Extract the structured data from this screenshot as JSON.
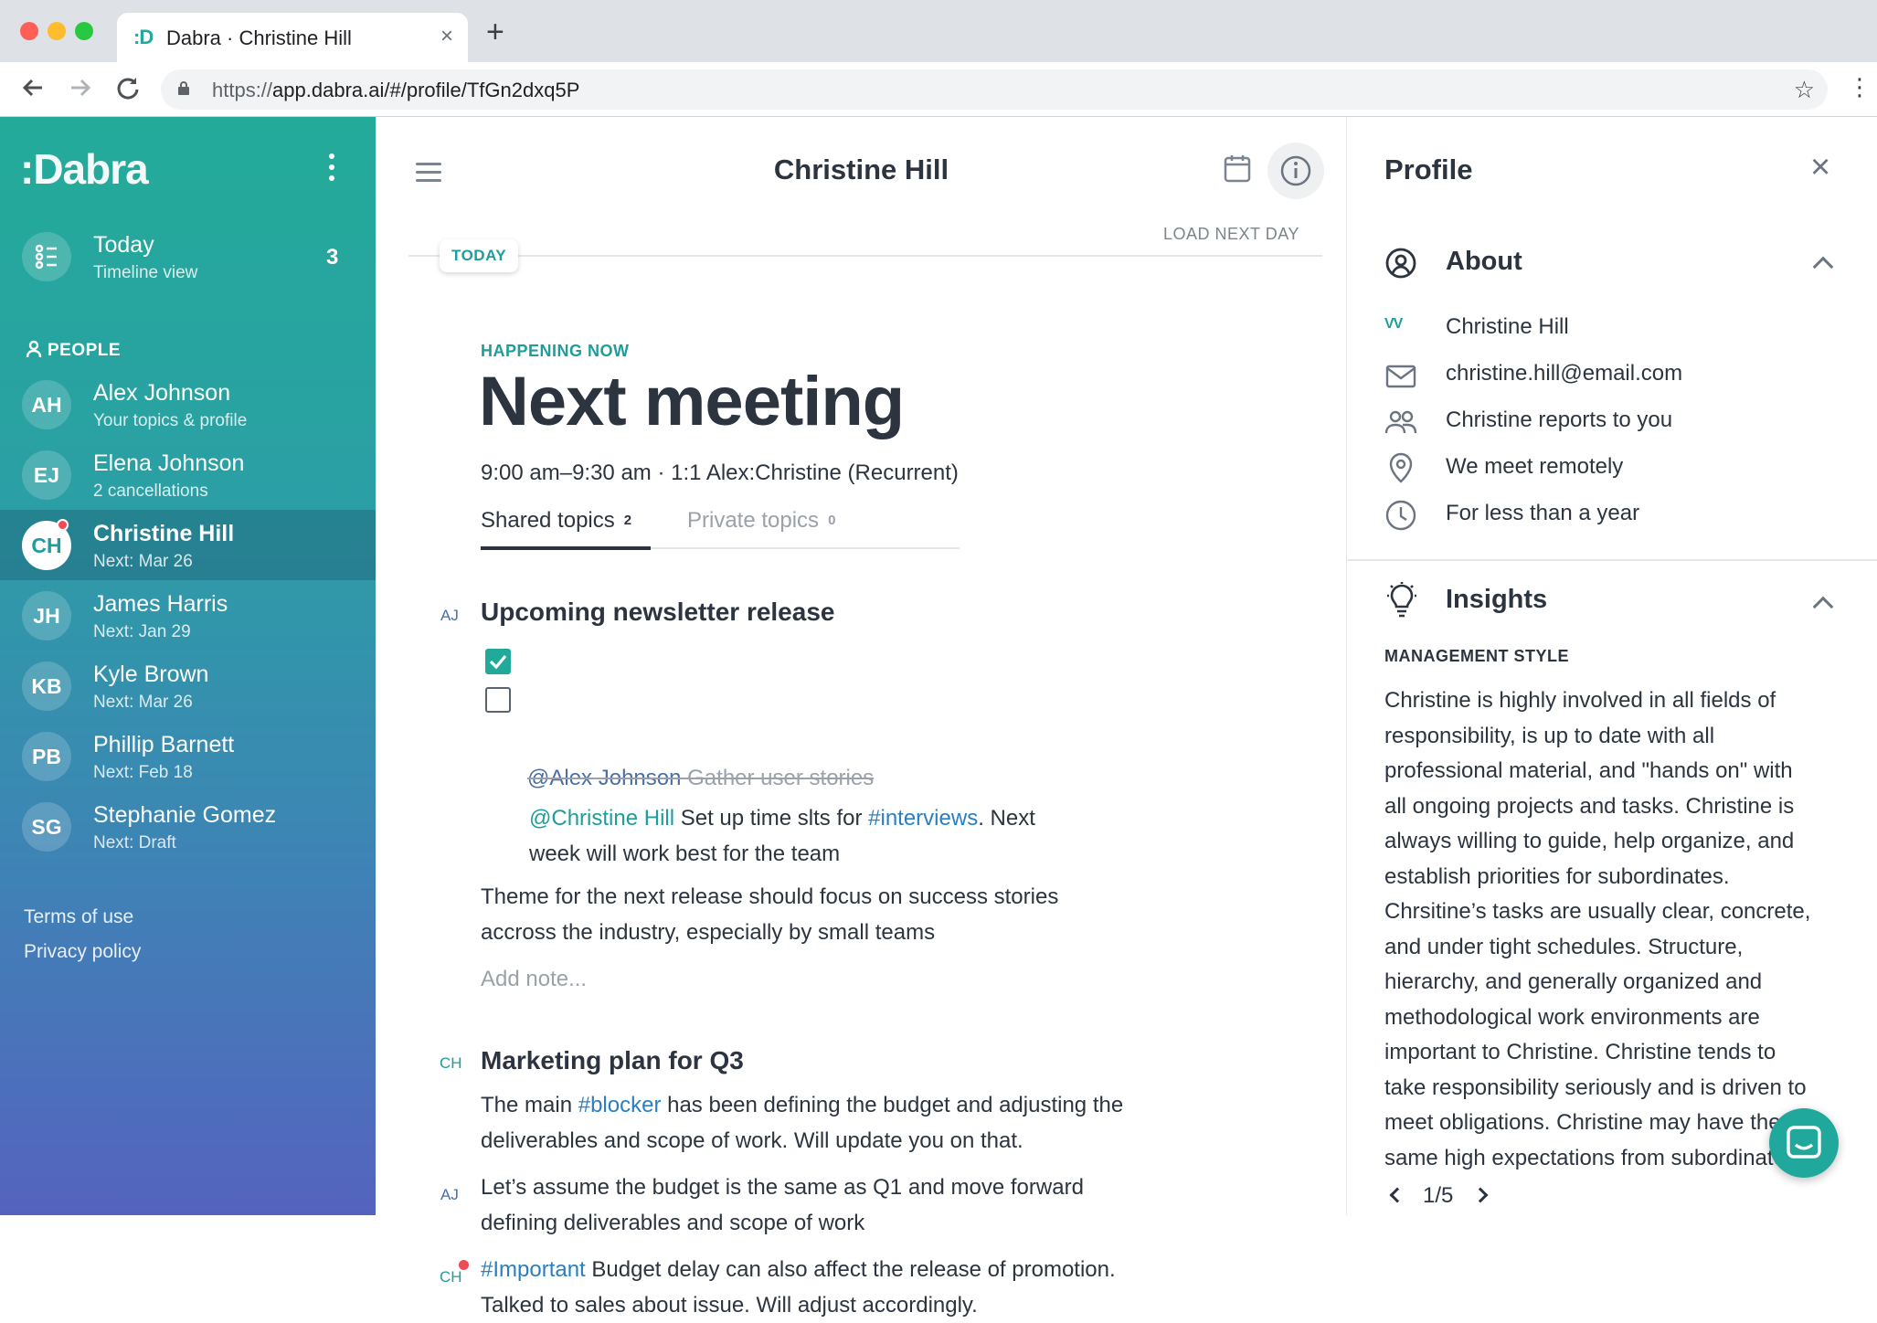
{
  "browser": {
    "tab_favicon": ":D",
    "tab_title": "Dabra · Christine Hill",
    "tab_close": "×",
    "new_tab": "+",
    "url_scheme": "https://",
    "url_rest": "app.dabra.ai/#/profile/TfGn2dxq5P"
  },
  "sidebar": {
    "logo": ":Dabra",
    "today": {
      "title": "Today",
      "subtitle": "Timeline view",
      "count": "3"
    },
    "people_heading": "PEOPLE",
    "people": [
      {
        "initials": "AH",
        "name": "Alex Johnson",
        "sub": "Your topics & profile"
      },
      {
        "initials": "EJ",
        "name": "Elena Johnson",
        "sub": "2 cancellations"
      },
      {
        "initials": "CH",
        "name": "Christine Hill",
        "sub": "Next: Mar 26"
      },
      {
        "initials": "JH",
        "name": "James Harris",
        "sub": "Next: Jan 29"
      },
      {
        "initials": "KB",
        "name": "Kyle Brown",
        "sub": "Next: Mar 26"
      },
      {
        "initials": "PB",
        "name": "Phillip Barnett",
        "sub": "Next: Feb 18"
      },
      {
        "initials": "SG",
        "name": "Stephanie Gomez",
        "sub": "Next: Draft"
      }
    ],
    "footer": {
      "terms": "Terms of use",
      "privacy": "Privacy policy"
    }
  },
  "main": {
    "title": "Christine Hill",
    "load_next": "LOAD NEXT DAY",
    "today_pill": "TODAY",
    "happening": "HAPPENING NOW",
    "meeting_title": "Next meeting",
    "meeting_time": "9:00 am–9:30 am · 1:1 Alex:Christine (Recurrent)",
    "tabs": [
      {
        "label": "Shared topics",
        "count": "2"
      },
      {
        "label": "Private topics",
        "count": "0"
      }
    ],
    "topic1": {
      "author": "AJ",
      "title": "Upcoming newsletter release",
      "task1_mention": "@Alex Johnson",
      "task1_text": " Gather user stories",
      "task2_mention": "@Christine Hill",
      "task2_text_a": " Set up time slts for ",
      "task2_tag": "#interviews",
      "task2_text_b": ". Next",
      "task2_line2": "week will work best for the team",
      "note_line1": "Theme for the next release should focus on success stories",
      "note_line2": "accross the industry, especially by small teams",
      "add_note": "Add note..."
    },
    "topic2": {
      "author": "CH",
      "title": "Marketing plan for Q3",
      "line1_a": "The main ",
      "line1_tag": "#blocker",
      "line1_b": " has been defining the budget and adjusting the",
      "line2": "deliverables and scope of work. Will update you on that.",
      "c1_author": "AJ",
      "c1_line1": "Let’s assume the budget is the same as Q1 and move forward",
      "c1_line2": "defining deliverables and scope of work",
      "c2_author": "CH",
      "c2_tag": "#Important",
      "c2_line1": " Budget delay can also affect the release of promotion.",
      "c2_line2": "Talked to sales about issue. Will adjust accordingly."
    }
  },
  "profile": {
    "title": "Profile",
    "about_heading": "About",
    "about_rows": {
      "initials_tag": "VV",
      "name": "Christine Hill",
      "email": "christine.hill@email.com",
      "reports": "Christine reports to you",
      "location": "We meet remotely",
      "duration": "For less than a year"
    },
    "insights_heading": "Insights",
    "management_style_label": "MANAGEMENT STYLE",
    "insight_lines": [
      "Christine is highly involved in all fields of",
      "responsibility, is up to date with all",
      "professional material, and \"hands on\" with",
      "all ongoing projects and tasks. Christine is",
      "always willing to guide, help organize, and",
      "establish priorities for subordinates.",
      "Chrsitine’s tasks are usually clear, concrete,",
      "and under tight schedules. Structure,",
      "hierarchy, and generally organized and",
      "methodological work environments are",
      "important to Christine. Christine tends to",
      "take responsibility seriously and is driven to",
      "meet obligations. Christine may have the",
      "same high expectations from subordinates"
    ],
    "pager": "1/5"
  },
  "colors": {
    "accent": "#22a99a",
    "heading": "#2c3440",
    "link": "#2a7fc0",
    "alert": "#ef4b55"
  }
}
